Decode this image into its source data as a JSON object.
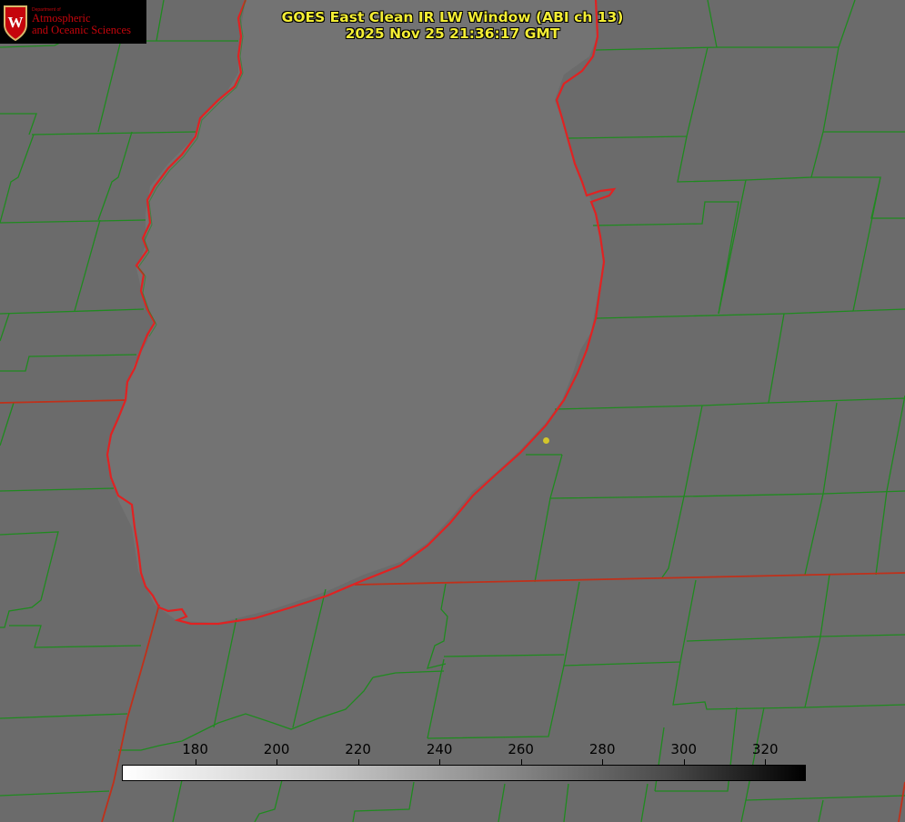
{
  "title": {
    "line1": "GOES East Clean IR LW Window (ABI ch 13)",
    "line2": "2025 Nov 25 21:36:17 GMT"
  },
  "logo": {
    "dept": "Department of",
    "line1": "Atmospheric",
    "line2": "and Oceanic Sciences",
    "crest_letter": "W"
  },
  "colorbar": {
    "ticks": [
      "180",
      "200",
      "220",
      "240",
      "260",
      "280",
      "300",
      "320"
    ],
    "range": [
      162,
      330
    ],
    "colormap": "white-to-black grayscale"
  },
  "colors": {
    "background": "#6d6d6d",
    "lake": "#737373",
    "county_lines": "#1f8a1f",
    "state_lines": "#d62020",
    "coastline": "#e02222",
    "title": "#f4ee34",
    "logo_red": "#c5050c"
  }
}
